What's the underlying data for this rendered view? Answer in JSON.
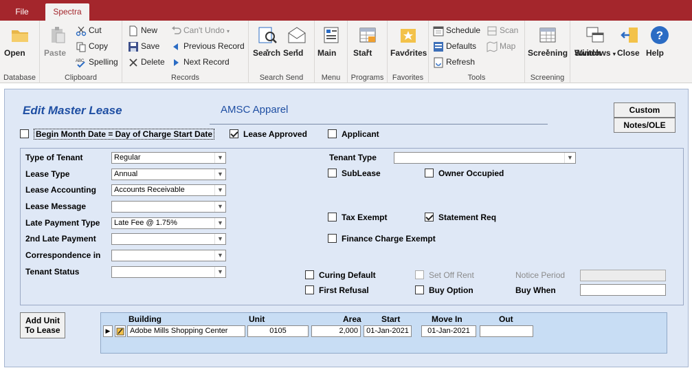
{
  "tabs": {
    "file": "File",
    "spectra": "Spectra"
  },
  "ribbon": {
    "database": {
      "label": "Database",
      "open": "Open"
    },
    "clipboard": {
      "label": "Clipboard",
      "paste": "Paste",
      "cut": "Cut",
      "copy": "Copy",
      "spelling": "Spelling"
    },
    "records": {
      "label": "Records",
      "new": "New",
      "save": "Save",
      "delete": "Delete",
      "cant_undo": "Can't Undo",
      "previous": "Previous Record",
      "next": "Next Record"
    },
    "search_send": {
      "label": "Search Send",
      "search": "Search",
      "send": "Send"
    },
    "menu": {
      "label": "Menu",
      "main": "Main"
    },
    "programs": {
      "label": "Programs",
      "start": "Start"
    },
    "favorites": {
      "label": "Favorites",
      "favorites": "Favorites"
    },
    "tools": {
      "label": "Tools",
      "schedule": "Schedule",
      "scan": "Scan",
      "defaults": "Defaults",
      "map": "Map",
      "refresh": "Refresh"
    },
    "screening": {
      "label": "Screening",
      "screening": "Screening"
    },
    "window": {
      "switch": "Switch",
      "windows": "Windows",
      "close": "Close",
      "help": "Help"
    }
  },
  "form": {
    "title": "Edit Master Lease",
    "tenant_name": "AMSC Apparel",
    "custom_button": "Custom",
    "notes_button": "Notes/OLE",
    "begin_month": {
      "label": "Begin Month Date = Day of Charge Start Date",
      "checked": false
    },
    "lease_approved": {
      "label": "Lease Approved",
      "checked": true
    },
    "applicant": {
      "label": "Applicant",
      "checked": false
    },
    "type_of_tenant": {
      "label": "Type of Tenant",
      "value": "Regular"
    },
    "lease_type": {
      "label": "Lease Type",
      "value": "Annual"
    },
    "lease_accounting": {
      "label": "Lease Accounting",
      "value": "Accounts Receivable"
    },
    "lease_message": {
      "label": "Lease Message",
      "value": ""
    },
    "late_payment_type": {
      "label": "Late Payment Type",
      "value": "Late Fee @ 1.75%"
    },
    "second_late_payment": {
      "label": "2nd Late Payment",
      "value": ""
    },
    "correspondence_in": {
      "label": "Correspondence in",
      "value": ""
    },
    "tenant_status": {
      "label": "Tenant Status",
      "value": ""
    },
    "tenant_type": {
      "label": "Tenant Type",
      "value": ""
    },
    "sublease": {
      "label": "SubLease",
      "checked": false
    },
    "owner_occupied": {
      "label": "Owner Occupied",
      "checked": false
    },
    "tax_exempt": {
      "label": "Tax Exempt",
      "checked": false
    },
    "statement_req": {
      "label": "Statement Req",
      "checked": true
    },
    "finance_charge_exempt": {
      "label": "Finance Charge Exempt",
      "checked": false
    },
    "curing_default": {
      "label": "Curing Default",
      "checked": false
    },
    "set_off_rent": {
      "label": "Set Off Rent",
      "checked": false
    },
    "notice_period": {
      "label": "Notice Period",
      "value": ""
    },
    "first_refusal": {
      "label": "First Refusal",
      "checked": false
    },
    "buy_option": {
      "label": "Buy Option",
      "checked": false
    },
    "buy_when": {
      "label": "Buy When",
      "value": ""
    },
    "add_unit": {
      "line1": "Add Unit",
      "line2": "To Lease"
    }
  },
  "units": {
    "columns": [
      "Building",
      "Unit",
      "Area",
      "Start",
      "Move In",
      "Out"
    ],
    "rows": [
      {
        "building": "Adobe Mills Shopping Center",
        "unit": "0105",
        "area": "2,000",
        "start": "01-Jan-2021",
        "move_in": "01-Jan-2021",
        "out": ""
      }
    ]
  }
}
